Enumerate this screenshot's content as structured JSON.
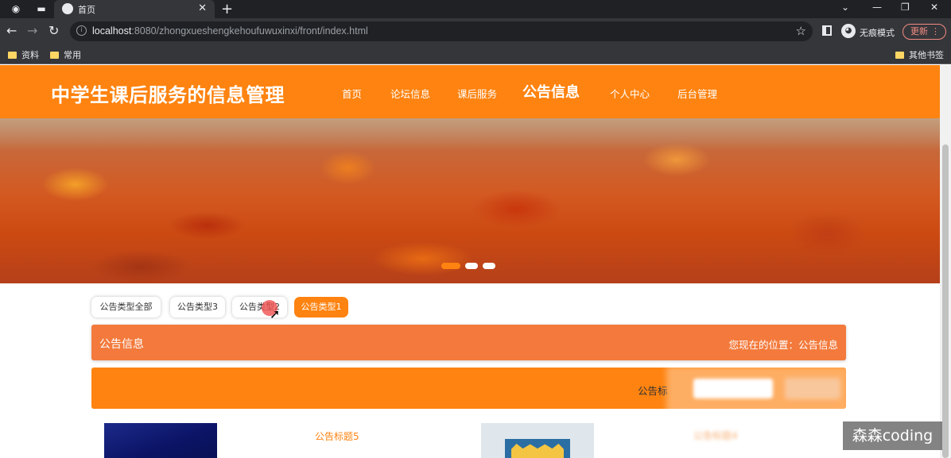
{
  "browser": {
    "active_tab_title": "首页",
    "url_host": "localhost",
    "url_rest": ":8080/zhongxueshengkehoufuwuxinxi/front/index.html",
    "incognito_label": "无痕模式",
    "update_label": "更新",
    "bookmarks": [
      "资料",
      "常用"
    ],
    "other_bookmarks": "其他书签"
  },
  "site": {
    "title": "中学生课后服务的信息管理",
    "menu": [
      "首页",
      "论坛信息",
      "课后服务",
      "公告信息",
      "个人中心",
      "后台管理"
    ],
    "active_menu": "公告信息"
  },
  "banner": {
    "slide_count": 3,
    "active_slide": 1
  },
  "type_tabs": [
    "公告类型全部",
    "公告类型3",
    "公告类型2",
    "公告类型1"
  ],
  "active_type_tab": "公告类型1",
  "breadcrumb": {
    "title": "公告信息",
    "position": "您现在的位置：公告信息"
  },
  "search": {
    "label": "公告标"
  },
  "items": [
    {
      "title": "公告标题5"
    },
    {
      "title": "公告标题4"
    }
  ],
  "watermark": "森森coding",
  "colors": {
    "brand": "#fe8310",
    "crumb": "#f37a3c"
  }
}
